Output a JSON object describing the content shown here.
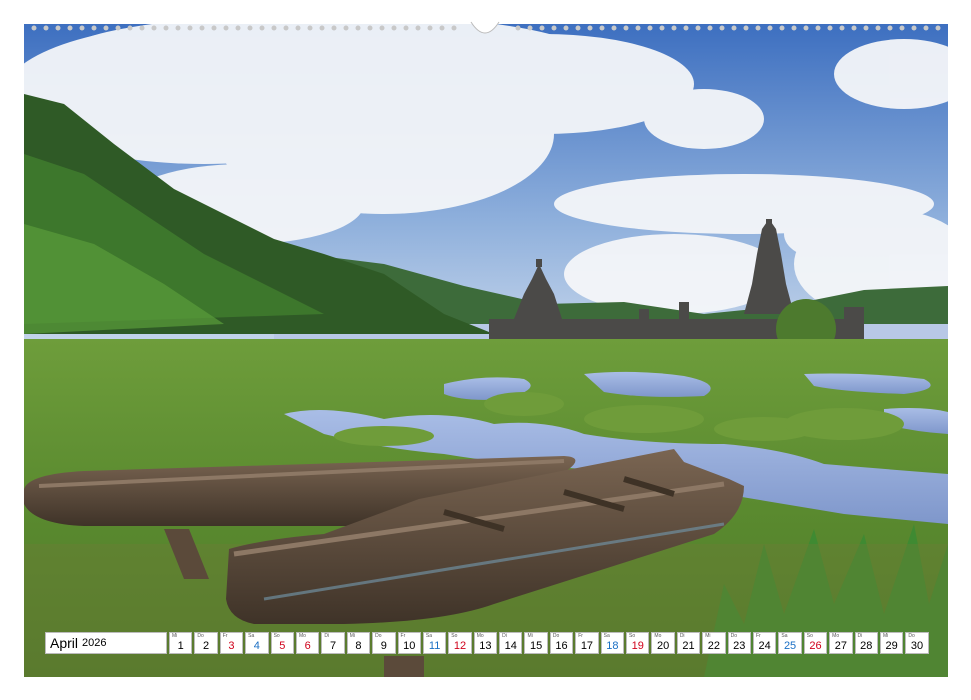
{
  "calendar": {
    "month": "April",
    "year": "2026",
    "days": [
      {
        "wd": "Mi",
        "d": "1",
        "t": ""
      },
      {
        "wd": "Do",
        "d": "2",
        "t": ""
      },
      {
        "wd": "Fr",
        "d": "3",
        "t": "hol"
      },
      {
        "wd": "Sa",
        "d": "4",
        "t": "sat"
      },
      {
        "wd": "So",
        "d": "5",
        "t": "sun"
      },
      {
        "wd": "Mo",
        "d": "6",
        "t": "hol"
      },
      {
        "wd": "Di",
        "d": "7",
        "t": ""
      },
      {
        "wd": "Mi",
        "d": "8",
        "t": ""
      },
      {
        "wd": "Do",
        "d": "9",
        "t": ""
      },
      {
        "wd": "Fr",
        "d": "10",
        "t": ""
      },
      {
        "wd": "Sa",
        "d": "11",
        "t": "sat"
      },
      {
        "wd": "So",
        "d": "12",
        "t": "sun"
      },
      {
        "wd": "Mo",
        "d": "13",
        "t": ""
      },
      {
        "wd": "Di",
        "d": "14",
        "t": ""
      },
      {
        "wd": "Mi",
        "d": "15",
        "t": ""
      },
      {
        "wd": "Do",
        "d": "16",
        "t": ""
      },
      {
        "wd": "Fr",
        "d": "17",
        "t": ""
      },
      {
        "wd": "Sa",
        "d": "18",
        "t": "sat"
      },
      {
        "wd": "So",
        "d": "19",
        "t": "sun"
      },
      {
        "wd": "Mo",
        "d": "20",
        "t": ""
      },
      {
        "wd": "Di",
        "d": "21",
        "t": ""
      },
      {
        "wd": "Mi",
        "d": "22",
        "t": ""
      },
      {
        "wd": "Do",
        "d": "23",
        "t": ""
      },
      {
        "wd": "Fr",
        "d": "24",
        "t": ""
      },
      {
        "wd": "Sa",
        "d": "25",
        "t": "sat"
      },
      {
        "wd": "So",
        "d": "26",
        "t": "sun"
      },
      {
        "wd": "Mo",
        "d": "27",
        "t": ""
      },
      {
        "wd": "Di",
        "d": "28",
        "t": ""
      },
      {
        "wd": "Mi",
        "d": "29",
        "t": ""
      },
      {
        "wd": "Do",
        "d": "30",
        "t": ""
      }
    ]
  },
  "colors": {
    "sky": "#4a7fc7",
    "cloud": "#f2f4f7",
    "forest": "#2f5a26",
    "grass": "#5f8f35",
    "water": "#8ea7d6",
    "boat": "#5a4a3c",
    "saturday": "#1a6fc4",
    "sunday": "#d0021b"
  }
}
